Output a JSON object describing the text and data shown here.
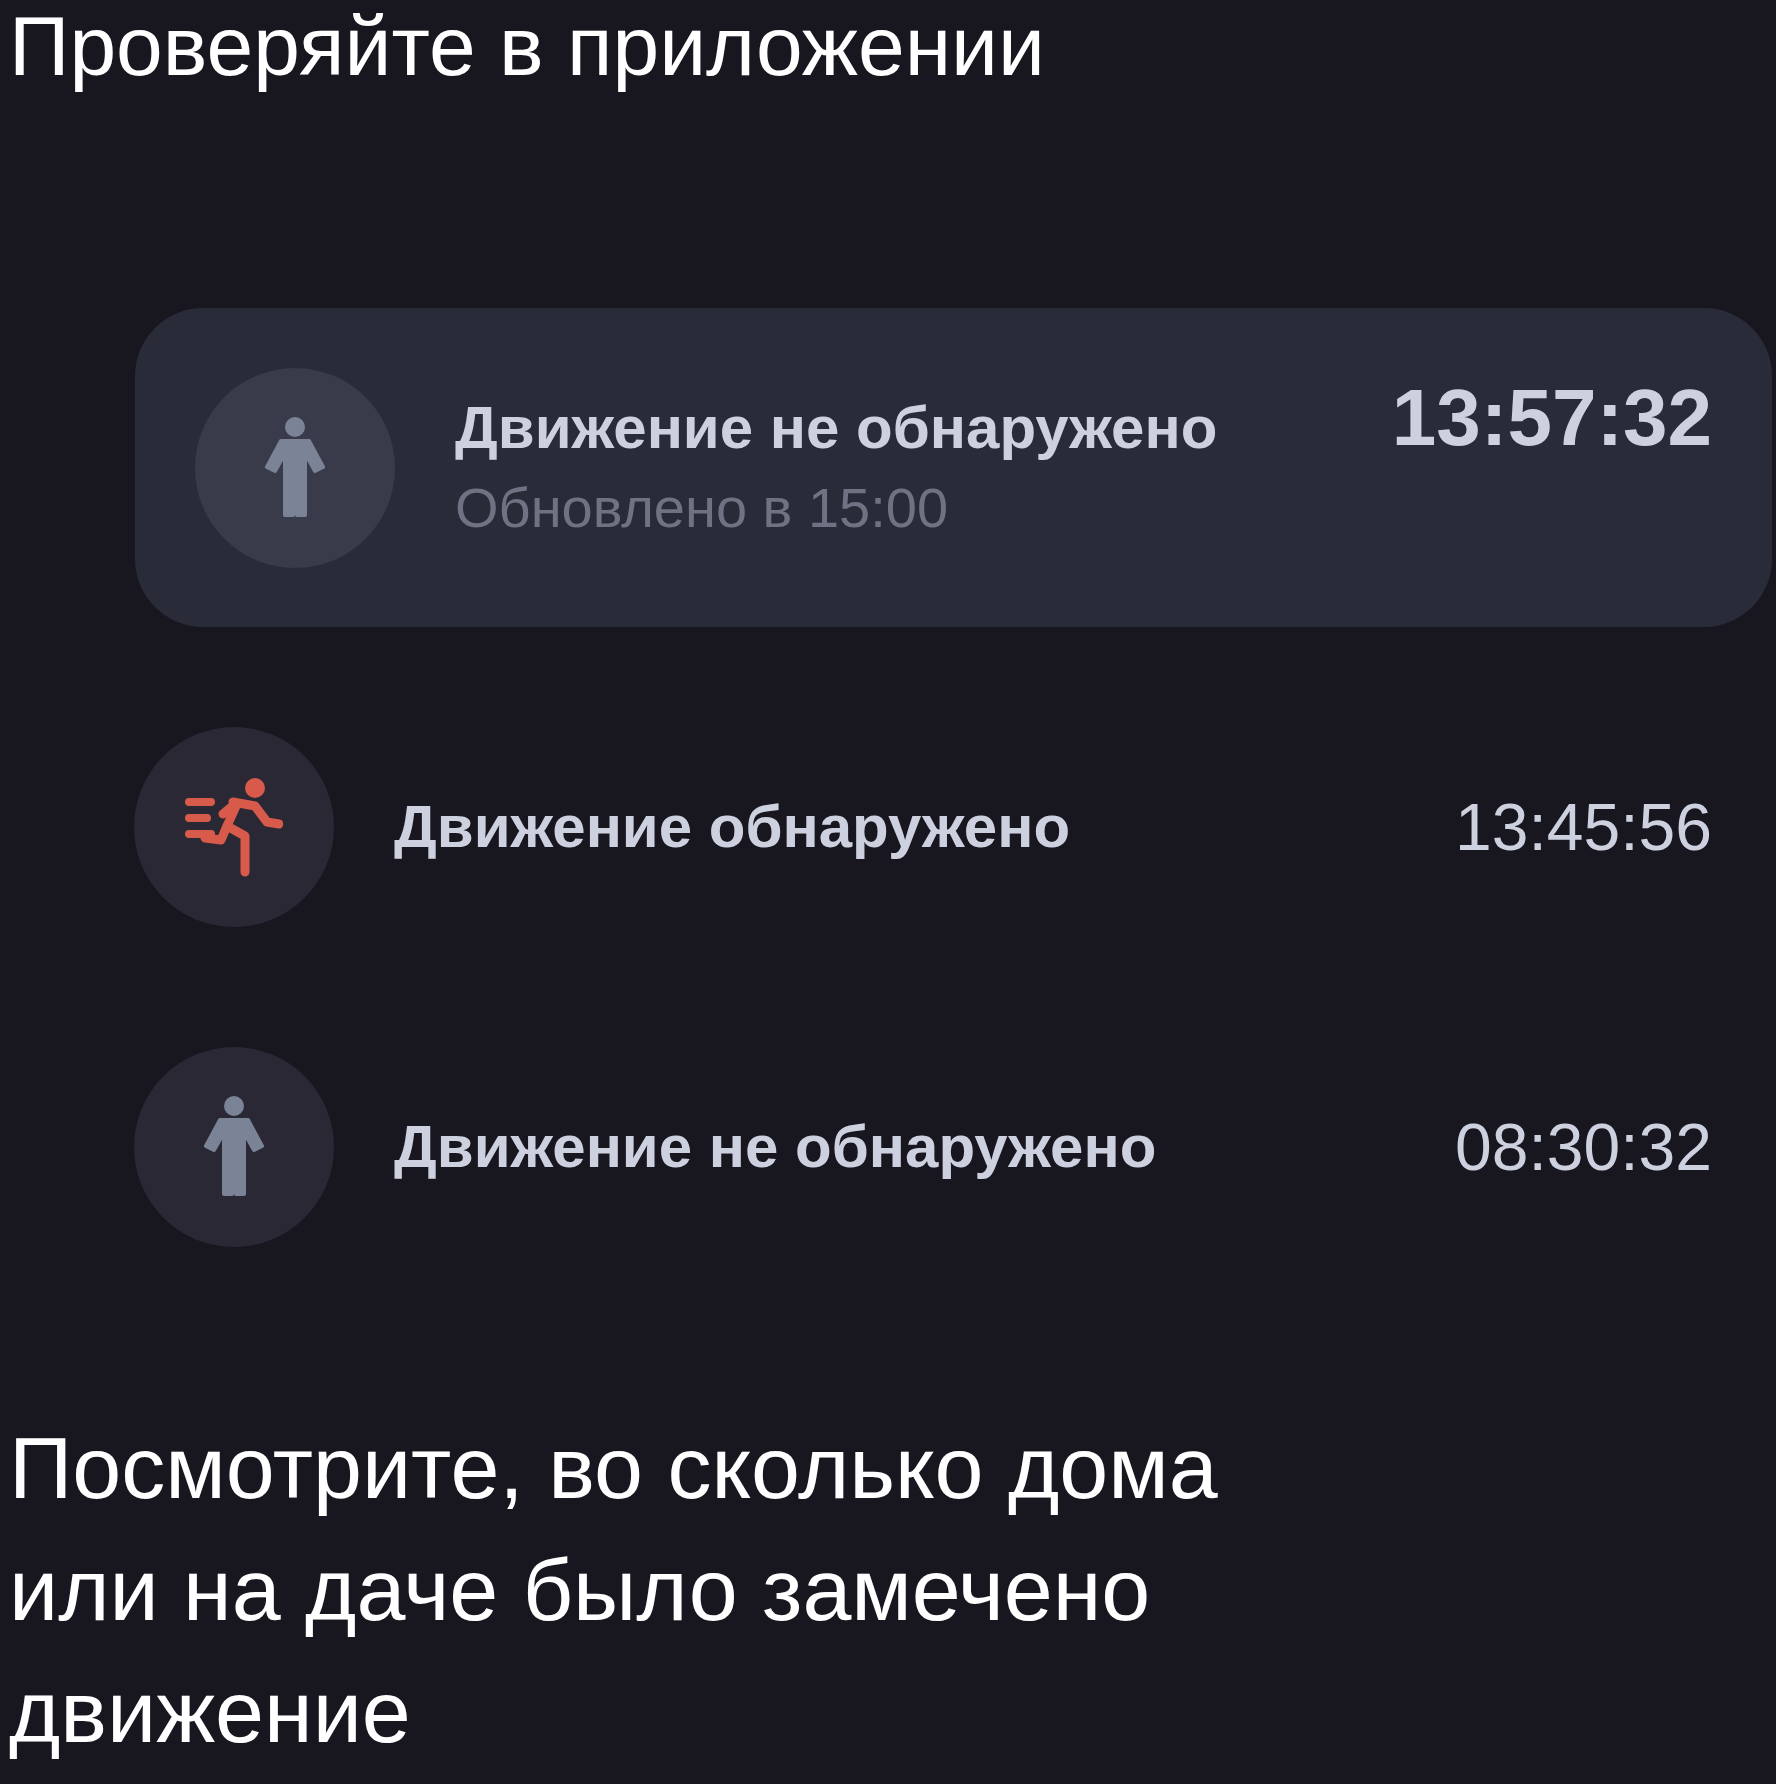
{
  "heading": "Проверяйте в приложении",
  "events": [
    {
      "kind": "no_motion",
      "title": "Движение не обнаружено",
      "time": "13:57:32",
      "subtitle": "Обновлено в 15:00",
      "selected": true
    },
    {
      "kind": "motion",
      "title": "Движение обнаружено",
      "time": "13:45:56",
      "selected": false
    },
    {
      "kind": "no_motion",
      "title": "Движение не обнаружено",
      "time": "08:30:32",
      "selected": false
    }
  ],
  "footer": "Посмотрите, во сколько дома или на даче было замечено движение"
}
